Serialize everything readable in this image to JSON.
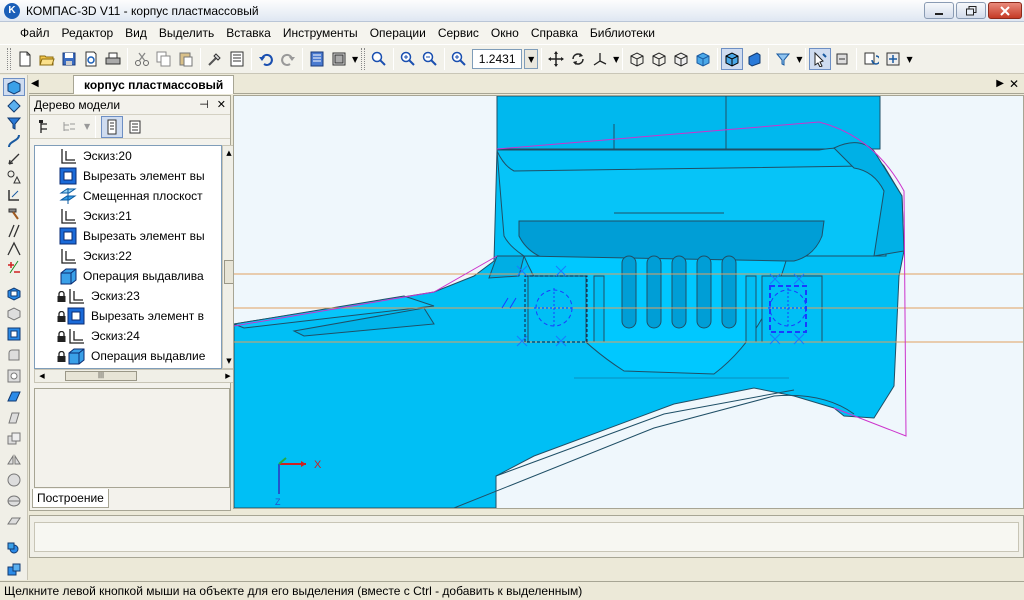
{
  "window": {
    "title": "КОМПАС-3D V11 - корпус пластмассовый",
    "app_icon_letter": "K",
    "controls": [
      "minimize",
      "restore",
      "close"
    ]
  },
  "menu": [
    "Файл",
    "Редактор",
    "Вид",
    "Выделить",
    "Вставка",
    "Инструменты",
    "Операции",
    "Сервис",
    "Окно",
    "Справка",
    "Библиотеки"
  ],
  "toolbar": {
    "zoom_value": "1.2431",
    "icons": [
      "new-doc-icon",
      "open-folder-icon",
      "save-icon",
      "print-preview-icon",
      "print-icon",
      "cut-icon",
      "copy-icon",
      "paste-icon",
      "properties-icon",
      "list-icon",
      "undo-icon",
      "redo-icon",
      "manager-icon",
      "library-icon",
      "zoom-window-icon",
      "zoom-in-icon",
      "zoom-out-icon",
      "zoom-scale-icon",
      "pan-icon",
      "rotate-icon",
      "orientation-icon",
      "wireframe-icon",
      "hidden-lines-icon",
      "no-hidden-lines-icon",
      "halftone-icon",
      "halftone-edges-icon",
      "perspective-icon",
      "filter-icon",
      "select-icon",
      "dimensions-icon",
      "rebuild-icon",
      "parameters-icon"
    ]
  },
  "document_tab": {
    "label": "корпус пластмассовый"
  },
  "model_tree": {
    "title": "Дерево модели",
    "items": [
      {
        "label": "Эскиз:20",
        "icon": "sketch-icon",
        "locked": false,
        "indent": 1
      },
      {
        "label": "Вырезать элемент вы",
        "icon": "cut-extrude-icon",
        "locked": false,
        "indent": 1
      },
      {
        "label": "Смещенная плоскост",
        "icon": "offset-plane-icon",
        "locked": false,
        "indent": 1
      },
      {
        "label": "Эскиз:21",
        "icon": "sketch-icon",
        "locked": false,
        "indent": 1
      },
      {
        "label": "Вырезать элемент вы",
        "icon": "cut-extrude-icon",
        "locked": false,
        "indent": 1
      },
      {
        "label": "Эскиз:22",
        "icon": "sketch-icon",
        "locked": false,
        "indent": 1
      },
      {
        "label": "Операция выдавлива",
        "icon": "extrude-icon",
        "locked": false,
        "indent": 1
      },
      {
        "label": "Эскиз:23",
        "icon": "sketch-icon",
        "locked": true,
        "indent": 2
      },
      {
        "label": "Вырезать элемент в",
        "icon": "cut-extrude-icon",
        "locked": true,
        "indent": 2
      },
      {
        "label": "Эскиз:24",
        "icon": "sketch-icon",
        "locked": true,
        "indent": 2
      },
      {
        "label": "Операция выдавлие",
        "icon": "extrude-icon",
        "locked": true,
        "indent": 2
      }
    ],
    "bottom_tab": "Построение"
  },
  "viewport": {
    "axis_x_label": "X",
    "axis_z_label": "Z",
    "colors": {
      "body": "#00bff5",
      "body_dark": "#0096c8",
      "edge": "#1f4f66",
      "outline": "#cc33cc",
      "plane_line": "#e0a060",
      "sketch": "#1a3cff",
      "background": "#eff7fc"
    }
  },
  "status": {
    "message": "Щелкните левой кнопкой мыши на объекте для его выделения (вместе с Ctrl - добавить к выделенным)"
  }
}
